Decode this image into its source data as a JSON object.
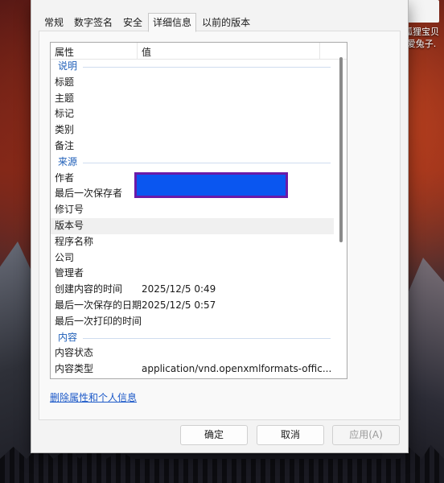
{
  "desktop": {
    "icon_label_line1": "狐狸宝贝",
    "icon_label_line2": "爱兔子."
  },
  "dialog": {
    "tabs": [
      {
        "label": "常规"
      },
      {
        "label": "数字签名"
      },
      {
        "label": "安全"
      },
      {
        "label": "详细信息"
      },
      {
        "label": "以前的版本"
      }
    ],
    "active_tab": "详细信息",
    "columns": {
      "name": "属性",
      "value": "值"
    },
    "rows": [
      {
        "type": "group",
        "name": "说明"
      },
      {
        "type": "prop",
        "name": "标题",
        "value": ""
      },
      {
        "type": "prop",
        "name": "主题",
        "value": ""
      },
      {
        "type": "prop",
        "name": "标记",
        "value": ""
      },
      {
        "type": "prop",
        "name": "类别",
        "value": ""
      },
      {
        "type": "prop",
        "name": "备注",
        "value": ""
      },
      {
        "type": "group",
        "name": "来源"
      },
      {
        "type": "prop",
        "name": "作者",
        "value": ""
      },
      {
        "type": "prop",
        "name": "最后一次保存者",
        "value": ""
      },
      {
        "type": "prop",
        "name": "修订号",
        "value": ""
      },
      {
        "type": "prop",
        "name": "版本号",
        "value": "",
        "highlighted": true
      },
      {
        "type": "prop",
        "name": "程序名称",
        "value": ""
      },
      {
        "type": "prop",
        "name": "公司",
        "value": ""
      },
      {
        "type": "prop",
        "name": "管理者",
        "value": ""
      },
      {
        "type": "prop",
        "name": "创建内容的时间",
        "value": "2025/12/5 0:49"
      },
      {
        "type": "prop",
        "name": "最后一次保存的日期",
        "value": "2025/12/5 0:57"
      },
      {
        "type": "prop",
        "name": "最后一次打印的时间",
        "value": ""
      },
      {
        "type": "group",
        "name": "内容"
      },
      {
        "type": "prop",
        "name": "内容状态",
        "value": ""
      },
      {
        "type": "prop",
        "name": "内容类型",
        "value": "application/vnd.openxmlformats-offic..."
      }
    ],
    "remove_link": "删除属性和个人信息",
    "buttons": {
      "ok": "确定",
      "cancel": "取消",
      "apply": "应用(A)"
    }
  },
  "colors": {
    "redaction_fill": "#0a56f0",
    "redaction_border": "#6a1aa8",
    "group_header": "#1e5eb8",
    "link": "#1b58c8"
  }
}
